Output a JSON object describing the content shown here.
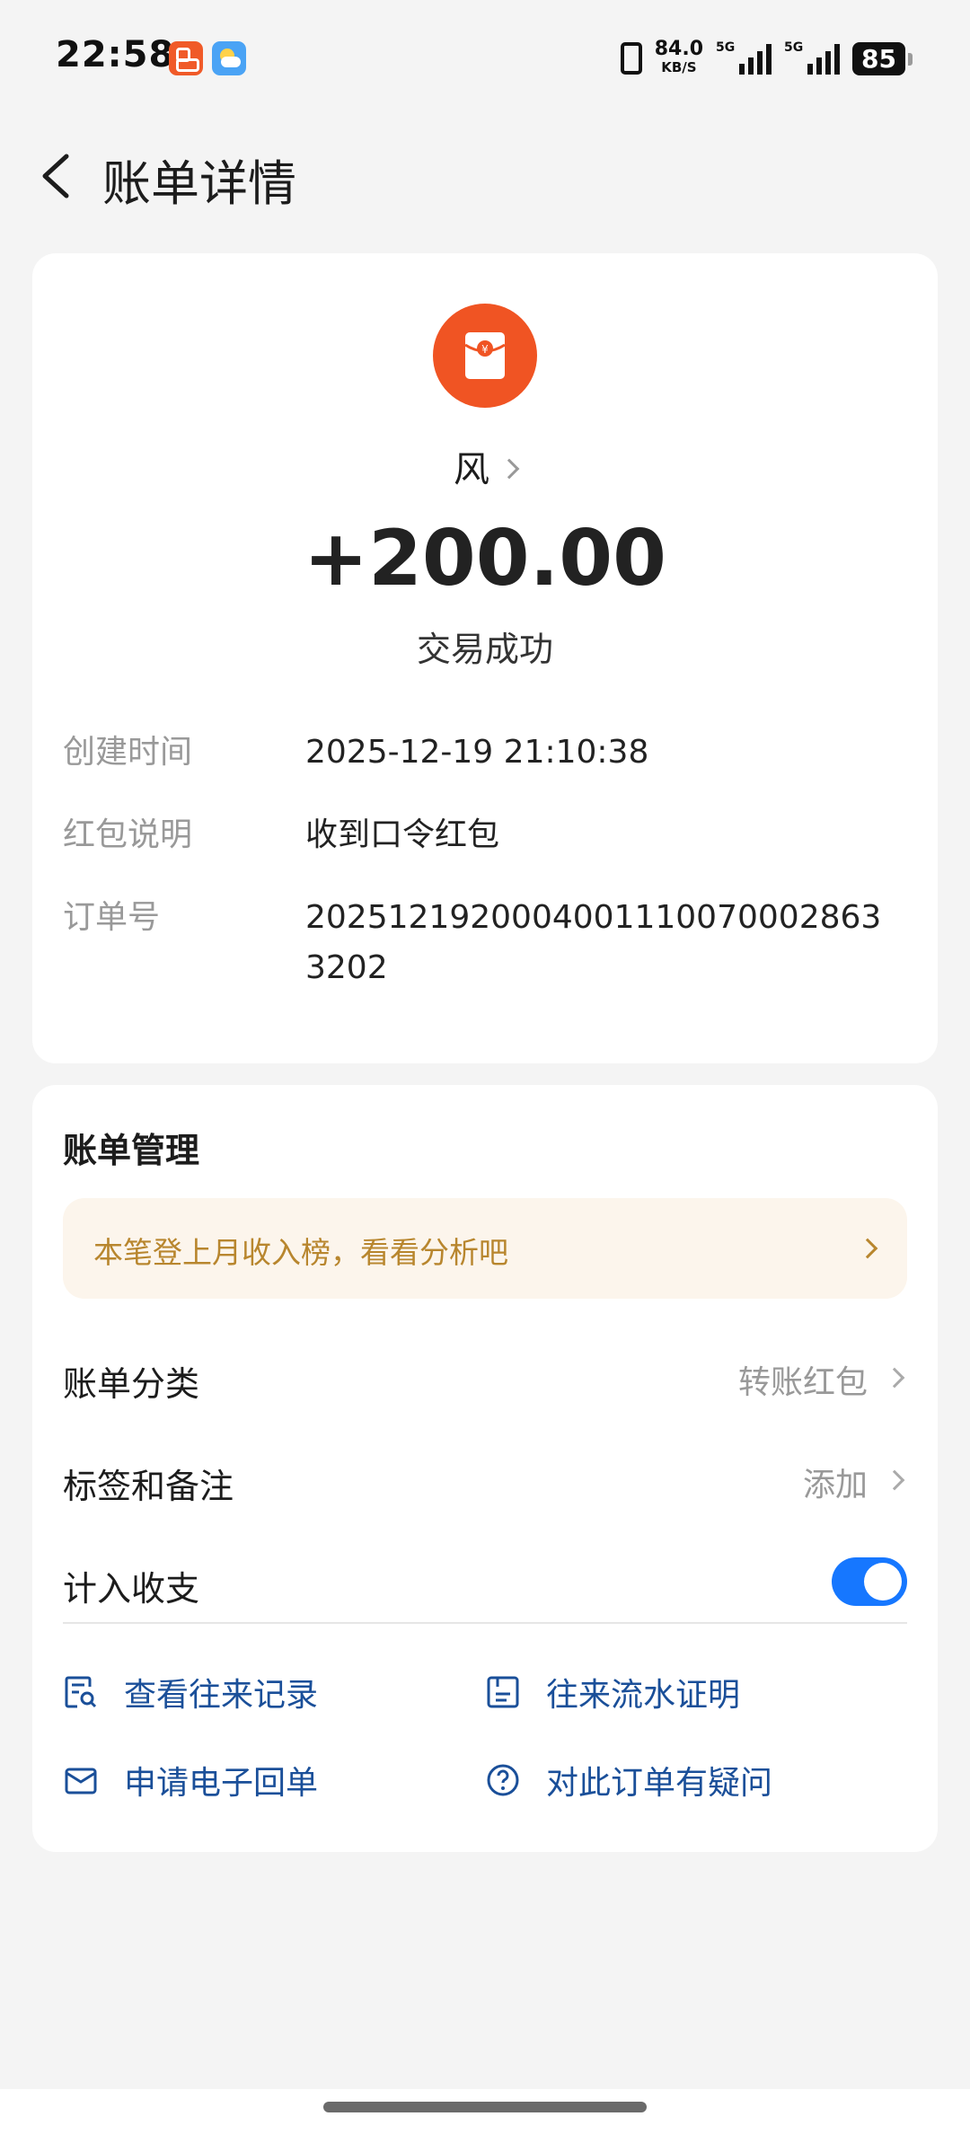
{
  "status_bar": {
    "time": "22:58",
    "speed_value": "84.0",
    "speed_unit": "KB/S",
    "sim1_tag": "5G",
    "sim2_tag": "5G",
    "battery": "85"
  },
  "header": {
    "title": "账单详情"
  },
  "transaction": {
    "counterparty": "风",
    "amount": "+200.00",
    "status": "交易成功",
    "icon": "red-packet-icon",
    "icon_color": "#f05423"
  },
  "details": [
    {
      "label": "创建时间",
      "value": "2025-12-19 21:10:38"
    },
    {
      "label": "红包说明",
      "value": "收到口令红包"
    },
    {
      "label": "订单号",
      "value": "20251219200040011100700028633202"
    }
  ],
  "management": {
    "title": "账单管理",
    "banner": "本笔登上月收入榜，看看分析吧",
    "category_label": "账单分类",
    "category_value": "转账红包",
    "tags_label": "标签和备注",
    "tags_value": "添加",
    "include_label": "计入收支",
    "include_enabled": true,
    "accent": "#1677ff"
  },
  "links": [
    {
      "label": "查看往来记录",
      "icon": "record-search-icon"
    },
    {
      "label": "往来流水证明",
      "icon": "statement-icon"
    },
    {
      "label": "申请电子回单",
      "icon": "mail-icon"
    },
    {
      "label": "对此订单有疑问",
      "icon": "question-icon"
    }
  ]
}
